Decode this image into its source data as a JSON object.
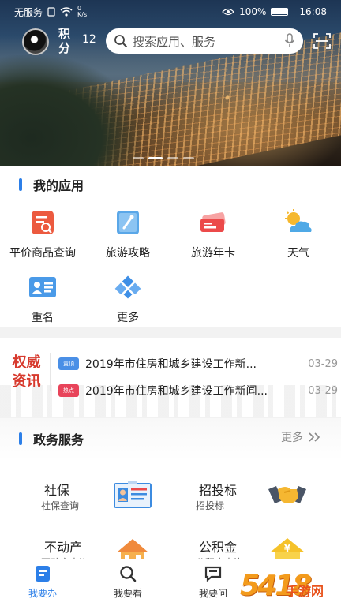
{
  "status_bar": {
    "carrier": "无服务",
    "network_speed": "0\nK/s",
    "battery": "100%",
    "time": "16:08"
  },
  "header": {
    "points_label": "积分",
    "points_value": "12",
    "search_placeholder": "搜索应用、服务"
  },
  "my_apps": {
    "title": "我的应用",
    "items": [
      {
        "label": "平价商品查询",
        "icon": "price-query-icon"
      },
      {
        "label": "旅游攻略",
        "icon": "travel-guide-icon"
      },
      {
        "label": "旅游年卡",
        "icon": "travel-card-icon"
      },
      {
        "label": "天气",
        "icon": "weather-icon"
      },
      {
        "label": "重名",
        "icon": "name-check-icon"
      },
      {
        "label": "更多",
        "icon": "more-apps-icon"
      }
    ]
  },
  "news": {
    "logo_line1": "权威",
    "logo_line2": "资讯",
    "items": [
      {
        "tag": "置顶",
        "tag_color": "#4a8fe6",
        "title": "2019年市住房和城乡建设工作新...",
        "date": "03-29"
      },
      {
        "tag": "热点",
        "tag_color": "#e8445a",
        "title": "2019年市住房和城乡建设工作新闻...",
        "date": "03-29"
      }
    ]
  },
  "gov_services": {
    "title": "政务服务",
    "more_label": "更多",
    "items": [
      {
        "name": "社保",
        "sub": "社保查询",
        "icon": "id-card-icon"
      },
      {
        "name": "招投标",
        "sub": "招投标",
        "icon": "handshake-icon"
      },
      {
        "name": "不动产",
        "sub": "不动产查询",
        "icon": "house-icon"
      },
      {
        "name": "公积金",
        "sub": "公积金查询",
        "icon": "house-yuan-icon"
      }
    ]
  },
  "bottom_nav": {
    "items": [
      {
        "label": "我要办",
        "active": true
      },
      {
        "label": "我要看",
        "active": false
      },
      {
        "label": "我要问",
        "active": false
      }
    ]
  },
  "watermark": {
    "main": "5418",
    "sub": "手游网"
  },
  "colors": {
    "accent": "#2c7fe8",
    "news_red": "#d73a2e"
  }
}
